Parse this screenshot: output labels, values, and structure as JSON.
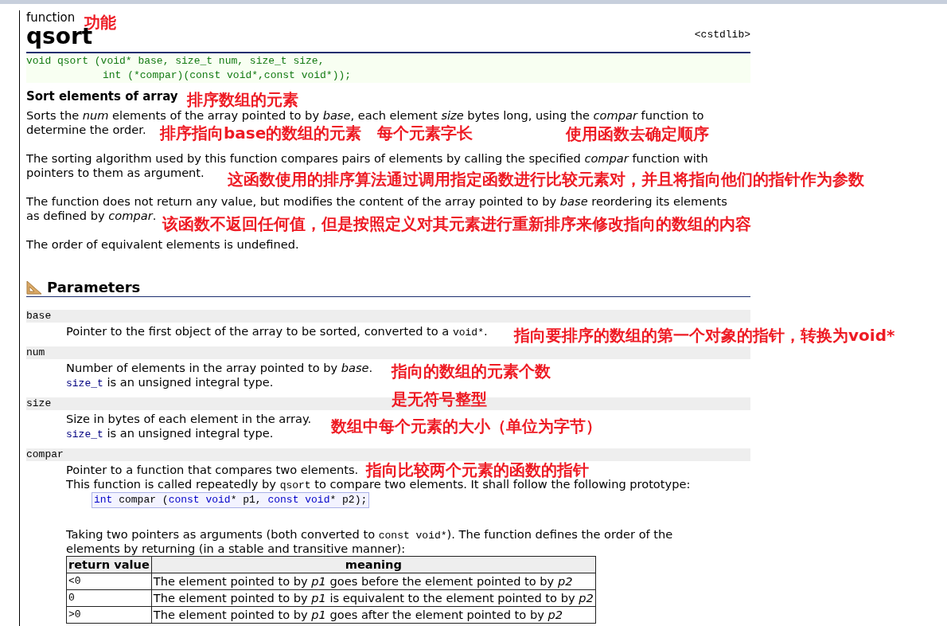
{
  "page": {
    "kind_label": "function",
    "title": "qsort",
    "header_file": "<cstdlib>"
  },
  "prototype": [
    {
      "text": "void qsort (void* base, size_t num, size_t size,",
      "continued": false
    },
    {
      "text": "int (*compar)(const void*,const void*));",
      "continued": true
    }
  ],
  "summary": "Sort elements of array",
  "description": [
    [
      "Sorts the *num* elements of the array pointed to by *base*, each element *size* bytes long, using the *compar* function to",
      "determine the order."
    ],
    [
      "The sorting algorithm used by this function compares pairs of elements by calling the specified *compar* function with",
      "pointers to them as argument."
    ],
    [
      "The function does not return any value, but modifies the content of the array pointed to by *base* reordering its elements",
      "as defined by *compar*."
    ],
    [
      "The order of equivalent elements is undefined."
    ]
  ],
  "parameters_heading": "Parameters",
  "parameters": [
    {
      "name": "base",
      "blocks": [
        {
          "kind": "text",
          "segments": [
            {
              "kind": "text",
              "text": "Pointer to the first object of the array to be sorted, converted to a "
            },
            {
              "kind": "code",
              "text": "void*"
            },
            {
              "kind": "text",
              "text": "."
            }
          ]
        }
      ]
    },
    {
      "name": "num",
      "blocks": [
        {
          "kind": "text",
          "segments": [
            {
              "kind": "text",
              "text": "Number of elements in the array pointed to by *base*."
            }
          ]
        },
        {
          "kind": "text",
          "segments": [
            {
              "kind": "link",
              "text": "size_t"
            },
            {
              "kind": "text",
              "text": " is an unsigned integral type."
            }
          ]
        }
      ]
    },
    {
      "name": "size",
      "blocks": [
        {
          "kind": "text",
          "segments": [
            {
              "kind": "text",
              "text": "Size in bytes of each element in the array."
            }
          ]
        },
        {
          "kind": "text",
          "segments": [
            {
              "kind": "link",
              "text": "size_t"
            },
            {
              "kind": "text",
              "text": " is an unsigned integral type."
            }
          ]
        }
      ]
    },
    {
      "name": "compar",
      "blocks": [
        {
          "kind": "text",
          "segments": [
            {
              "kind": "text",
              "text": "Pointer to a function that compares two elements."
            }
          ]
        },
        {
          "kind": "text",
          "segments": [
            {
              "kind": "text",
              "text": "This function is called repeatedly by "
            },
            {
              "kind": "code",
              "text": "qsort"
            },
            {
              "kind": "text",
              "text": " to compare two elements. It shall follow the following prototype:"
            }
          ]
        },
        {
          "kind": "sample",
          "segments": [
            {
              "kind": "keyword",
              "text": "int"
            },
            {
              "kind": "code",
              "text": " compar ("
            },
            {
              "kind": "keyword",
              "text": "const void"
            },
            {
              "kind": "code",
              "text": "* p1, "
            },
            {
              "kind": "keyword",
              "text": "const void"
            },
            {
              "kind": "code",
              "text": "* p2);"
            }
          ]
        },
        {
          "kind": "para",
          "segments": [
            {
              "kind": "text",
              "text": "Taking two pointers as arguments (both converted to "
            },
            {
              "kind": "code",
              "text": "const void*"
            },
            {
              "kind": "text",
              "text": "). The function defines the order of the"
            }
          ]
        },
        {
          "kind": "text",
          "segments": [
            {
              "kind": "text",
              "text": "elements by returning (in a stable and transitive manner):"
            }
          ]
        },
        {
          "kind": "table",
          "columns": [
            "return value",
            "meaning"
          ],
          "rows": [
            [
              "<0",
              "The element pointed to by *p1* goes before the element pointed to by *p2*"
            ],
            [
              "0",
              "The element pointed to by *p1* is equivalent to the element pointed to by *p2*"
            ],
            [
              ">0",
              "The element pointed to by *p1* goes after the element pointed to by *p2*"
            ]
          ]
        }
      ]
    }
  ],
  "annotations": [
    {
      "text": "功能"
    },
    {
      "text": "排序数组的元素"
    },
    {
      "text": "排序指向base的数组的元素"
    },
    {
      "text": "每个元素字长"
    },
    {
      "text": "使用函数去确定顺序"
    },
    {
      "text": "这函数使用的排序算法通过调用指定函数进行比较元素对，并且将指向他们的指针作为参数"
    },
    {
      "text": "该函数不返回任何值，但是按照定义对其元素进行重新排序来修改指向的数组的内容"
    },
    {
      "text": "指向要排序的数组的第一个对象的指针，转换为void*"
    },
    {
      "text": "指向的数组的元素个数"
    },
    {
      "text": "是无符号整型"
    },
    {
      "text": "数组中每个元素的大小（单位为字节）"
    },
    {
      "text": "指向比较两个元素的函数的指针"
    }
  ]
}
